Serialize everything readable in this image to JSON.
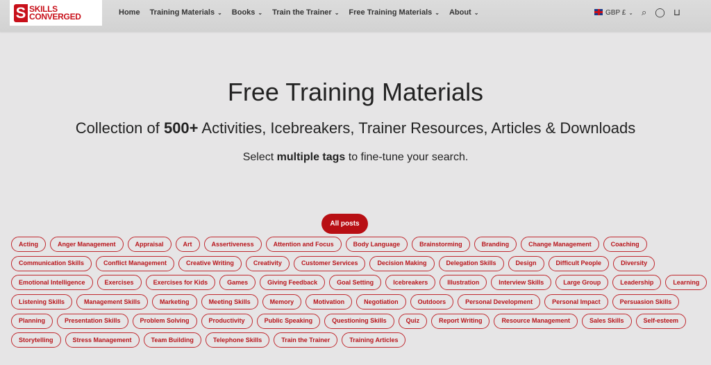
{
  "header": {
    "logo_text_1": "SKILLS",
    "logo_text_2": "CONVERGED",
    "nav": [
      "Home",
      "Training Materials",
      "Books",
      "Train the Trainer",
      "Free Training Materials",
      "About"
    ],
    "currency": "GBP £"
  },
  "hero": {
    "title": "Free Training Materials",
    "subtitle_pre": "Collection of ",
    "subtitle_bold": "500+",
    "subtitle_post": " Activities, Icebreakers, Trainer Resources, Articles & Downloads",
    "select_pre": "Select ",
    "select_bold": "multiple tags",
    "select_post": " to fine-tune your search."
  },
  "all_posts": "All posts",
  "accent": "#b80f14",
  "tag_rows": [
    [
      "Acting",
      "Anger Management",
      "Appraisal",
      "Art",
      "Assertiveness",
      "Attention and Focus",
      "Body Language",
      "Brainstorming",
      "Branding",
      "Change Management",
      "Coaching"
    ],
    [
      "Communication Skills",
      "Conflict Management",
      "Creative Writing",
      "Creativity",
      "Customer Services",
      "Decision Making",
      "Delegation Skills",
      "Design",
      "Difficult People",
      "Diversity"
    ],
    [
      "Emotional Intelligence",
      "Exercises",
      "Exercises for Kids",
      "Games",
      "Giving Feedback",
      "Goal Setting",
      "Icebreakers",
      "Illustration",
      "Interview Skills",
      "Large Group",
      "Leadership",
      "Learning"
    ],
    [
      "Listening Skills",
      "Management Skills",
      "Marketing",
      "Meeting Skills",
      "Memory",
      "Motivation",
      "Negotiation",
      "Outdoors",
      "Personal Development",
      "Personal Impact",
      "Persuasion Skills"
    ],
    [
      "Planning",
      "Presentation Skills",
      "Problem Solving",
      "Productivity",
      "Public Speaking",
      "Questioning Skills",
      "Quiz",
      "Report Writing",
      "Resource Management",
      "Sales Skills",
      "Self-esteem"
    ],
    [
      "Storytelling",
      "Stress Management",
      "Team Building",
      "Telephone Skills",
      "Train the Trainer",
      "Training Articles"
    ]
  ]
}
